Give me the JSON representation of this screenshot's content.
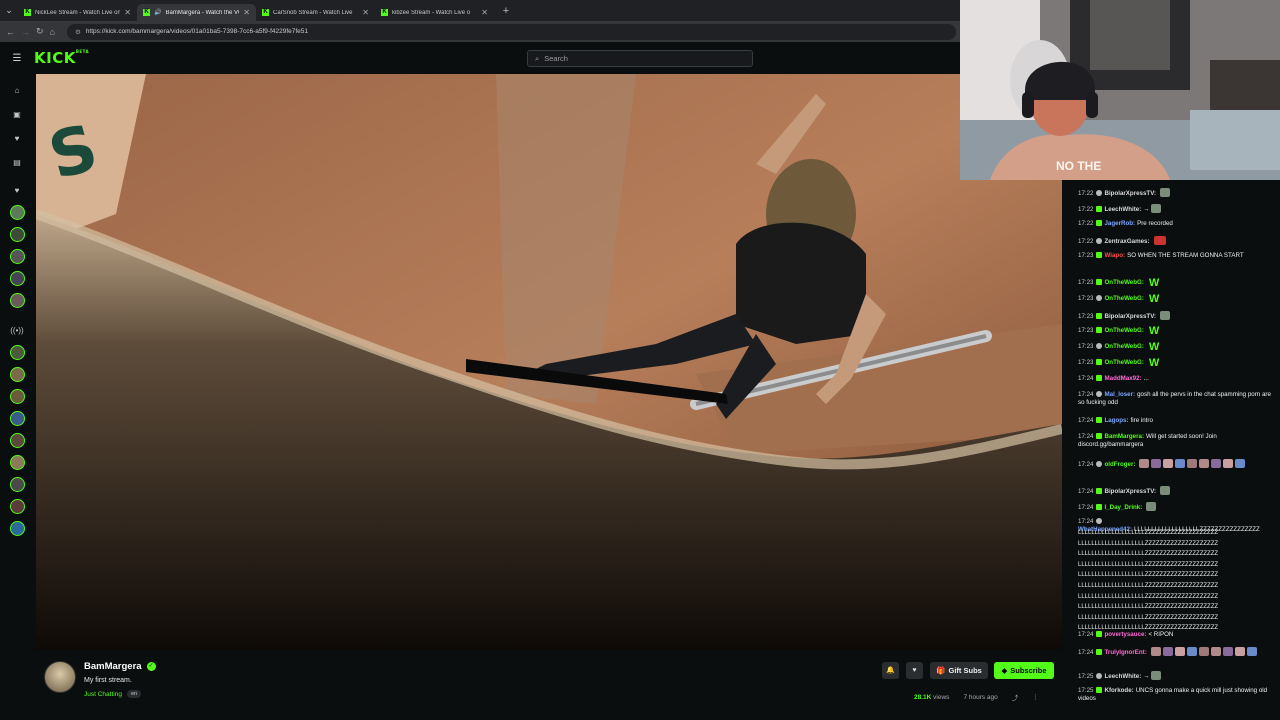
{
  "browser": {
    "tabs": [
      {
        "title": "NickLee Stream - Watch Live on Ki",
        "active": false
      },
      {
        "title": "BamMargera - Watch the VOD",
        "active": true
      },
      {
        "title": "CarSnob Stream - Watch Live",
        "active": false
      },
      {
        "title": "kibzee Stream - Watch Live o",
        "active": false
      }
    ],
    "url": "https://kick.com/bammargera/videos/01a01ba5-7398-7cc6-a5f9-f4229fe7fe51"
  },
  "header": {
    "logo": "KICK",
    "logo_badge": "BETA",
    "search_placeholder": "Search"
  },
  "stream": {
    "channel": "BamMargera",
    "title": "My first stream.",
    "category": "Just Chatting",
    "tag": "en",
    "gift_label": "Gift Subs",
    "subscribe_label": "Subscribe",
    "views": "28.1K",
    "views_suffix": "views",
    "time_ago": "7 hours ago"
  },
  "webcam": {
    "shirt_text": "NO THE"
  },
  "chat": [
    {
      "time": "17:22",
      "user": "BipolarXpressTV:",
      "text": "",
      "color": "#d8d8d8",
      "emote": "sm"
    },
    {
      "time": "17:22",
      "user": "LeechWhite:",
      "text": "→",
      "color": "#d8d8d8",
      "emote": "sm"
    },
    {
      "time": "17:22",
      "user": "JagerRob:",
      "text": "Pre recorded",
      "color": "#7aa7ff",
      "emote": ""
    },
    {
      "time": "17:22",
      "user": "ZentraxGames:",
      "text": "",
      "color": "#d8d8d8",
      "emote": "red"
    },
    {
      "time": "17:23",
      "user": "Wiapo:",
      "text": "SO WHEN THE STREAM GONNA START",
      "color": "#ff4b4b",
      "emote": ""
    },
    {
      "time": "17:23",
      "user": "OnTheWebG:",
      "text": "W",
      "color": "#53fc18",
      "emote": ""
    },
    {
      "time": "17:23",
      "user": "OnTheWebG:",
      "text": "W",
      "color": "#53fc18",
      "emote": ""
    },
    {
      "time": "17:23",
      "user": "BipolarXpressTV:",
      "text": "",
      "color": "#d8d8d8",
      "emote": "sm"
    },
    {
      "time": "17:23",
      "user": "OnTheWebG:",
      "text": "W",
      "color": "#53fc18",
      "emote": ""
    },
    {
      "time": "17:23",
      "user": "OnTheWebG:",
      "text": "W",
      "color": "#53fc18",
      "emote": ""
    },
    {
      "time": "17:23",
      "user": "OnTheWebG:",
      "text": "W",
      "color": "#53fc18",
      "emote": ""
    },
    {
      "time": "17:24",
      "user": "MaddMax92:",
      "text": "...",
      "color": "#ff6ad5",
      "emote": ""
    },
    {
      "time": "17:24",
      "user": "Mal_loser:",
      "text": "gosh all the pervs in the chat spamming porn are so fucking odd",
      "color": "#7aa7ff",
      "emote": ""
    },
    {
      "time": "17:24",
      "user": "Lagops:",
      "text": "fire intro",
      "color": "#7aa7ff",
      "emote": ""
    },
    {
      "time": "17:24",
      "user": "BamMargera:",
      "text": "Will get started soon! Join discord.gg/bammargera",
      "color": "#53fc18",
      "emote": ""
    },
    {
      "time": "17:24",
      "user": "oldFroger:",
      "text": "",
      "color": "#53fc18",
      "emote": "row"
    },
    {
      "time": "17:24",
      "user": "BipolarXpressTV:",
      "text": "",
      "color": "#d8d8d8",
      "emote": "sm"
    },
    {
      "time": "17:24",
      "user": "I_Day_Drink:",
      "text": "",
      "color": "#53fc18",
      "emote": "sm"
    },
    {
      "time": "17:24",
      "user": "WhatHappened42:",
      "text": "LLLLLLLLLLLLLLLLLLLZZZZZZZZZZZZZZZZ",
      "color": "#7aa7ff",
      "emote": ""
    },
    {
      "time": "17:24",
      "user": "povertysauce:",
      "text": "< RIPON",
      "color": "#ff6ad5",
      "emote": ""
    },
    {
      "time": "17:24",
      "user": "TrulyIgnorEnt:",
      "text": "",
      "color": "#ff6ad5",
      "emote": "row"
    },
    {
      "time": "17:25",
      "user": "LeechWhite:",
      "text": "→",
      "color": "#d8d8d8",
      "emote": "sm"
    },
    {
      "time": "17:25",
      "user": "Kforkode:",
      "text": "UNCS gonna make a quick mill just showing old videos",
      "color": "#d8d8d8",
      "emote": ""
    }
  ],
  "chat_spam_lines": [
    "LLLLLLLLLLLLLLLLLLLLZZZZZZZZZZZZZZZZZZZZ",
    "LLLLLLLLLLLLLLLLLLLLZZZZZZZZZZZZZZZZZZZZ",
    "LLLLLLLLLLLLLLLLLLLLZZZZZZZZZZZZZZZZZZZZ",
    "LLLLLLLLLLLLLLLLLLLLZZZZZZZZZZZZZZZZZZZZ",
    "LLLLLLLLLLLLLLLLLLLLZZZZZZZZZZZZZZZZZZZZ",
    "LLLLLLLLLLLLLLLLLLLLZZZZZZZZZZZZZZZZZZZZ",
    "LLLLLLLLLLLLLLLLLLLLZZZZZZZZZZZZZZZZZZZZ",
    "LLLLLLLLLLLLLLLLLLLLZZZZZZZZZZZZZZZZZZZZ",
    "LLLLLLLLLLLLLLLLLLLLZZZZZZZZZZZZZZZZZZZZ",
    "LLLLLLLLLLLLLLLLLLLLZZZZZZZZZZZZZZZZZZZZ"
  ],
  "colors": {
    "accent": "#53fc18",
    "bg": "#0b0e0f"
  }
}
